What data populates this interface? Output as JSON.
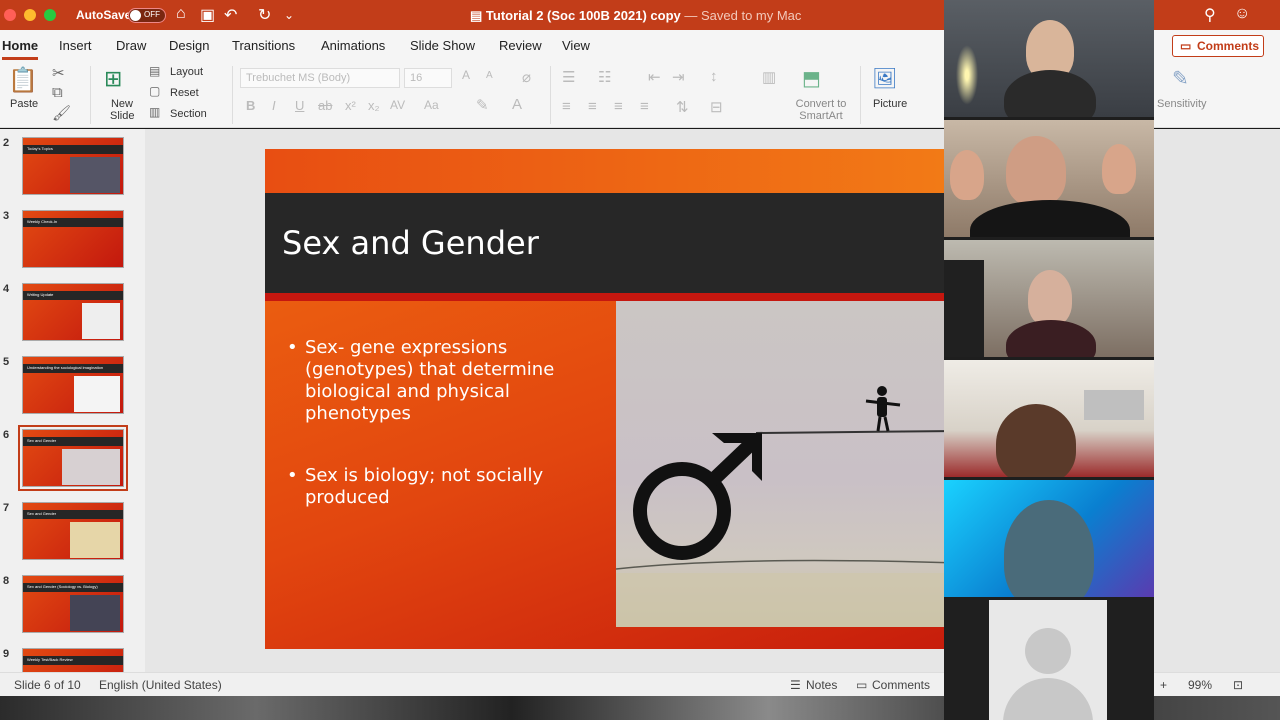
{
  "window": {
    "autosave_label": "AutoSave",
    "autosave_state": "OFF",
    "doc_title": "Tutorial 2 (Soc 100B 2021)  copy",
    "saved_status": "— Saved to my Mac"
  },
  "tabs": [
    "Home",
    "Insert",
    "Draw",
    "Design",
    "Transitions",
    "Animations",
    "Slide Show",
    "Review",
    "View"
  ],
  "comments_button": "Comments",
  "ribbon": {
    "paste": "Paste",
    "new_slide": "New Slide",
    "layout": "Layout",
    "reset": "Reset",
    "section": "Section",
    "font_name": "Trebuchet MS (Body)",
    "font_size": "16",
    "convert_smartart": "Convert to SmartArt",
    "picture": "Picture",
    "sensitivity": "Sensitivity"
  },
  "thumbnails": [
    {
      "num": "2",
      "title": "Today's Topics"
    },
    {
      "num": "3",
      "title": "Weekly Check-In"
    },
    {
      "num": "4",
      "title": "Writing Update"
    },
    {
      "num": "5",
      "title": "Understanding the sociological imagination"
    },
    {
      "num": "6",
      "title": "Sex and Gender"
    },
    {
      "num": "7",
      "title": "Sex and Gender"
    },
    {
      "num": "8",
      "title": "Sex and Gender (Sociology vs. Biology)"
    },
    {
      "num": "9",
      "title": "Weekly Test/Back Review"
    }
  ],
  "slide": {
    "title": "Sex and Gender",
    "bullets": [
      "Sex- gene expressions (genotypes) that determine biological and physical phenotypes",
      "Sex is biology; not socially produced"
    ]
  },
  "status": {
    "slide_counter": "Slide 6 of 10",
    "language": "English (United States)",
    "notes": "Notes",
    "comments": "Comments",
    "zoom": "99%"
  },
  "icons": {
    "home": "home-icon",
    "save": "save-icon",
    "undo": "undo-icon",
    "redo": "redo-icon",
    "search": "search-icon",
    "smiley": "smiley-icon",
    "comment": "comment-icon"
  }
}
